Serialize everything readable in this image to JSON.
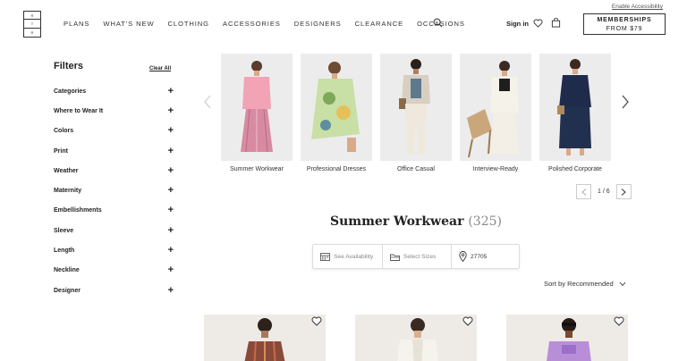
{
  "utility": {
    "accessibility_link": "Enable Accessibility"
  },
  "logo": {
    "marks": [
      "R",
      "T",
      "R"
    ]
  },
  "nav": {
    "items": [
      "PLANS",
      "WHAT'S NEW",
      "CLOTHING",
      "ACCESSORIES",
      "DESIGNERS",
      "CLEARANCE",
      "OCCASIONS"
    ],
    "sign_in": "Sign in",
    "membership_line1": "MEMBERSHIPS",
    "membership_line2": "FROM $79"
  },
  "filters": {
    "title": "Filters",
    "clear_all": "Clear All",
    "items": [
      "Categories",
      "Where to Wear It",
      "Colors",
      "Print",
      "Weather",
      "Maternity",
      "Embellishments",
      "Sleeve",
      "Length",
      "Neckline",
      "Designer"
    ]
  },
  "carousel": {
    "items": [
      "Summer Workwear",
      "Professional Dresses",
      "Office Casual",
      "Interview-Ready",
      "Polished Corporate"
    ],
    "page": "1 / 6"
  },
  "listing": {
    "title": "Summer Workwear",
    "count": "(325)",
    "availability_placeholder": "See Availability",
    "sizes_placeholder": "Select Sizes",
    "zip": "27705",
    "sort_label": "Sort by Recommended"
  },
  "colors": {
    "accent": "#222222",
    "border": "#dddddd",
    "photo_bg": "#efece8"
  }
}
